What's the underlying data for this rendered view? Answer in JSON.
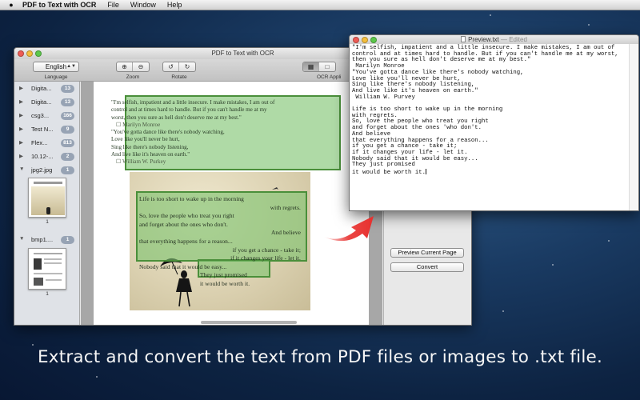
{
  "menubar": {
    "app_name": "PDF to Text with OCR",
    "items": [
      "File",
      "Window",
      "Help"
    ]
  },
  "main_window": {
    "title": "PDF to Text with OCR",
    "toolbar": {
      "language": {
        "value": "English",
        "caption": "Language"
      },
      "zoom_caption": "Zoom",
      "rotate_caption": "Rotate",
      "ocr_caption": "OCR Appli"
    },
    "sidebar": [
      {
        "name": "Digita...",
        "count": "13"
      },
      {
        "name": "Digita...",
        "count": "13"
      },
      {
        "name": "csg3...",
        "count": "166"
      },
      {
        "name": "Test N...",
        "count": "9"
      },
      {
        "name": "Flex...",
        "count": "813"
      },
      {
        "name": "10.12-...",
        "count": "2"
      },
      {
        "name": "jpg2.jpg",
        "count": "1",
        "expanded": true,
        "thumb_page": "1"
      },
      {
        "name": "bmp1....",
        "count": "1",
        "expanded": true,
        "thumb_page": "1"
      }
    ],
    "document": {
      "block1": [
        "\"I'm selfish, impatient and a little insecure. I make mistakes, I am out of",
        "control and at times hard to handle. But if you can't handle me at my",
        "worst, then you sure as hell don't deserve me at my best.\"",
        "☐ Marilyn Monroe",
        "\"You've gotta dance like there's nobody watching,",
        "Love like you'll never be hurt,",
        "Sing like there's nobody listening,",
        "And live like it's heaven on earth.\"",
        "☐ William W. Purkey"
      ],
      "block2": [
        "Life is too short to wake up in the morning",
        "with regrets.",
        "So, love the people who treat you right",
        "and forget about the ones who don't.",
        "And believe",
        "that everything happens for a reason...",
        "if you get a chance - take it;",
        "if it changes your life - let it.",
        "Nobody said that it would be easy...",
        "They just promised",
        "it would be worth it."
      ]
    },
    "right_panel": {
      "preview_button": "Preview Current Page",
      "convert_button": "Convert"
    }
  },
  "preview_window": {
    "filename": "Preview.txt",
    "status": "— Edited",
    "text": "\"I'm selfish, impatient and a little insecure. I make mistakes, I am out of\ncontrol and at times hard to handle. But if you can't handle me at my worst,\nthen you sure as hell don't deserve me at my best.\"\n Marilyn Monroe\n\"You've gotta dance like there's nobody watching,\nLove like you'll never be hurt,\nSing like there's nobody listening,\nAnd live like it's heaven on earth.\"\n William W. Purvey\n\nLife is too short to wake up in the morning\nwith regrets.\nSo, love the people who treat you right\nand forget about the ones 'who don't.\nAnd believe\nthat everything happens for a reason...\nif you get a chance - take it;\nif it changes your life - let it.\nNobody said that it would be easy...\nThey just promised\nit would be worth it."
  },
  "caption": "Extract and convert the text from PDF files or images to .txt file.",
  "colors": {
    "highlight_fill": "#7ec470",
    "highlight_border": "#4a8f3a",
    "arrow": "#e8312f",
    "badge": "#97a3b4"
  }
}
